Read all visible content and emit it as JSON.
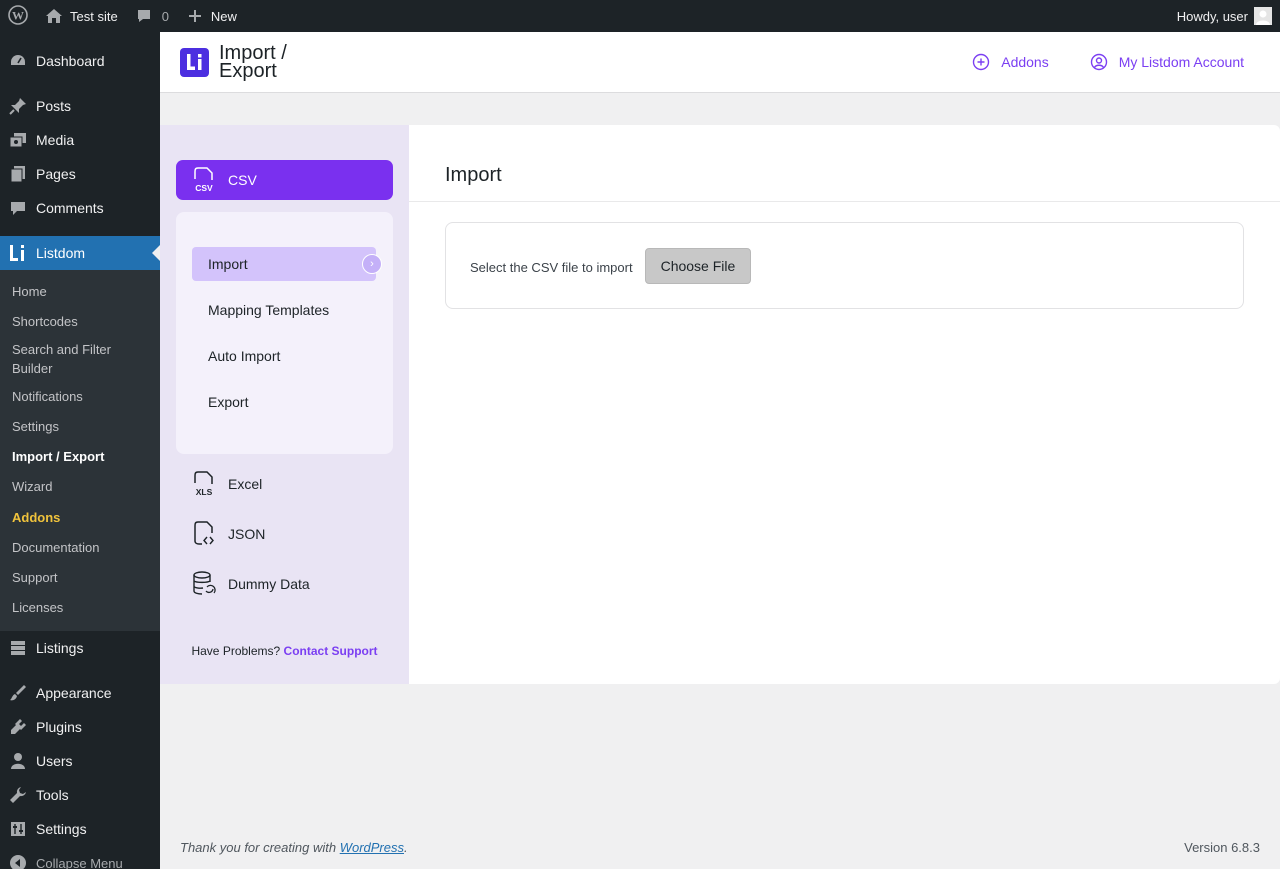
{
  "adminbar": {
    "site_name": "Test site",
    "comments_count": "0",
    "new_label": "New",
    "howdy": "Howdy, user"
  },
  "sidebar": {
    "items_top": [
      {
        "label": "Dashboard",
        "icon": "dashboard-icon"
      },
      {
        "label": "Posts",
        "icon": "pin-icon"
      },
      {
        "label": "Media",
        "icon": "media-icon"
      },
      {
        "label": "Pages",
        "icon": "pages-icon"
      },
      {
        "label": "Comments",
        "icon": "comment-icon"
      }
    ],
    "current": {
      "label": "Listdom",
      "icon": "listdom-icon"
    },
    "submenu": [
      "Home",
      "Shortcodes",
      "Search and Filter Builder",
      "Notifications",
      "Settings",
      "Import / Export",
      "Wizard",
      "Addons",
      "Documentation",
      "Support",
      "Licenses"
    ],
    "items_bottom": [
      {
        "label": "Listings",
        "icon": "listings-icon"
      },
      {
        "label": "Appearance",
        "icon": "brush-icon"
      },
      {
        "label": "Plugins",
        "icon": "plugin-icon"
      },
      {
        "label": "Users",
        "icon": "user-icon"
      },
      {
        "label": "Tools",
        "icon": "wrench-icon"
      },
      {
        "label": "Settings",
        "icon": "settings-icon"
      }
    ],
    "collapse": "Collapse Menu"
  },
  "header": {
    "logo_text": "Li",
    "title": "Import / Export",
    "addons": "Addons",
    "account": "My Listdom Account"
  },
  "panel": {
    "csv": "CSV",
    "sub_items": [
      "Import",
      "Mapping Templates",
      "Auto Import",
      "Export"
    ],
    "formats": [
      "Excel",
      "JSON",
      "Dummy Data"
    ],
    "help_text": "Have Problems?",
    "help_link": "Contact Support"
  },
  "content": {
    "title": "Import",
    "file_label": "Select the CSV file to import",
    "choose_button": "Choose File"
  },
  "footer": {
    "thanks": "Thank you for creating with",
    "wp_link": "WordPress",
    "version": "Version 6.8.3"
  },
  "colors": {
    "accent": "#7a30ef",
    "wp_blue": "#2271b1",
    "admin_dark": "#1d2327"
  }
}
